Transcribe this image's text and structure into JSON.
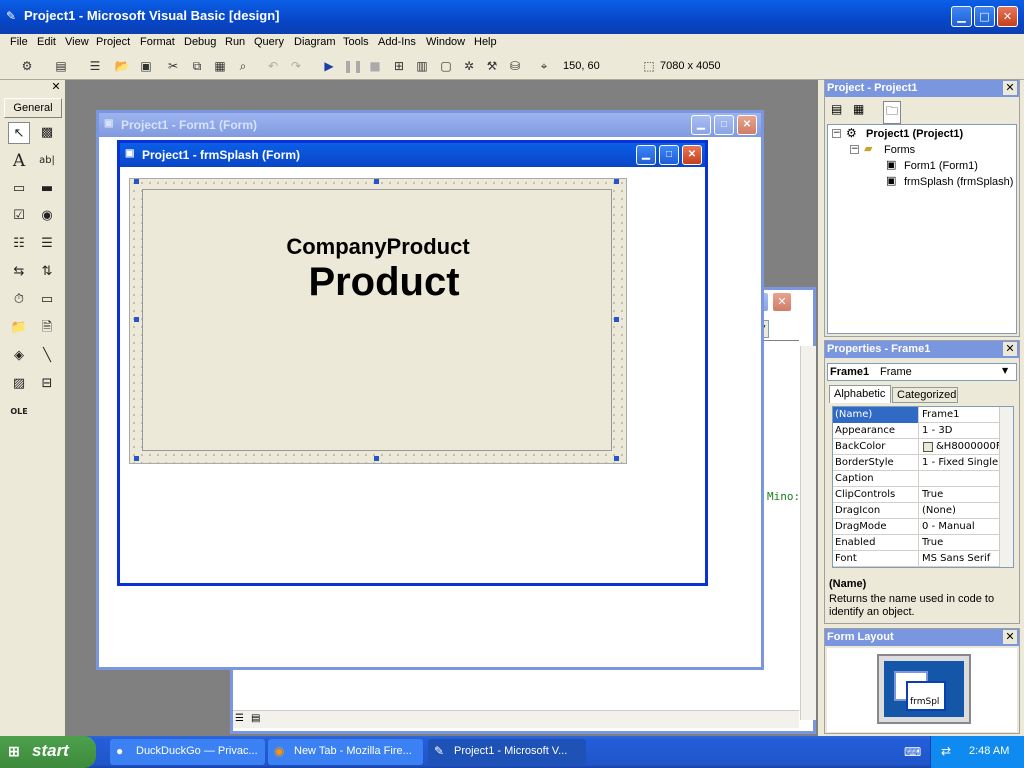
{
  "window": {
    "title": "Project1 - Microsoft Visual Basic [design]"
  },
  "menu": [
    "File",
    "Edit",
    "View",
    "Project",
    "Format",
    "Debug",
    "Run",
    "Query",
    "Diagram",
    "Tools",
    "Add-Ins",
    "Window",
    "Help"
  ],
  "toolbar": {
    "position": "150, 60",
    "size": "7080 x 4050"
  },
  "toolbox": {
    "tab_label": "General"
  },
  "form1": {
    "title": "Project1 - Form1 (Form)"
  },
  "splash": {
    "title": "Project1 - frmSplash (Form)",
    "company_product": "CompanyProduct",
    "product": "Product"
  },
  "code_window": {
    "snippet": "Mino:"
  },
  "project_panel": {
    "title": "Project - Project1",
    "root": "Project1 (Project1)",
    "folder": "Forms",
    "items": [
      "Form1 (Form1)",
      "frmSplash (frmSplash)"
    ]
  },
  "properties_panel": {
    "title": "Properties - Frame1",
    "object_name": "Frame1",
    "object_type": "Frame",
    "tabs": [
      "Alphabetic",
      "Categorized"
    ],
    "rows": [
      {
        "k": "(Name)",
        "v": "Frame1"
      },
      {
        "k": "Appearance",
        "v": "1 - 3D"
      },
      {
        "k": "BackColor",
        "v": "&H8000000F"
      },
      {
        "k": "BorderStyle",
        "v": "1 - Fixed Single"
      },
      {
        "k": "Caption",
        "v": ""
      },
      {
        "k": "ClipControls",
        "v": "True"
      },
      {
        "k": "DragIcon",
        "v": "(None)"
      },
      {
        "k": "DragMode",
        "v": "0 - Manual"
      },
      {
        "k": "Enabled",
        "v": "True"
      },
      {
        "k": "Font",
        "v": "MS Sans Serif"
      }
    ],
    "desc_title": "(Name)",
    "desc_text": "Returns the name used in code to identify an object."
  },
  "form_layout": {
    "title": "Form Layout",
    "mini_label": "frmSpl"
  },
  "taskbar": {
    "start": "start",
    "tasks": [
      "DuckDuckGo — Privac...",
      "New Tab - Mozilla Fire...",
      "Project1 - Microsoft V..."
    ],
    "clock": "2:48 AM"
  }
}
